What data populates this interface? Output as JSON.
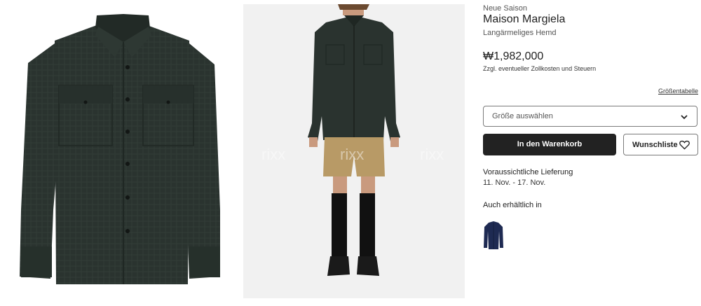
{
  "gallery": {
    "image1_alt": "Langärmeliges Hemd – Produktbild",
    "image2_alt": "Langärmeliges Hemd – Modelbild",
    "watermark": "rixx"
  },
  "product": {
    "season": "Neue Saison",
    "brand": "Maison Margiela",
    "name": "Langärmeliges Hemd",
    "price": "₩1,982,000",
    "duties_note": "Zzgl. eventueller Zollkosten und Steuern",
    "size_guide": "Größentabelle",
    "size_placeholder": "Größe auswählen",
    "add_to_cart": "In den Warenkorb",
    "wishlist": "Wunschliste",
    "delivery_title": "Voraussichtliche Lieferung",
    "delivery_dates": "11. Nov. - 17. Nov.",
    "also_available": "Auch erhältlich in"
  },
  "colors": {
    "shirt": "#2a332f",
    "shorts": "#b89a66",
    "button_dark": "#222222",
    "variant_navy": "#1e2a52"
  },
  "icons": {
    "size_dropdown": "chevron-down-icon",
    "wishlist": "heart-icon"
  }
}
